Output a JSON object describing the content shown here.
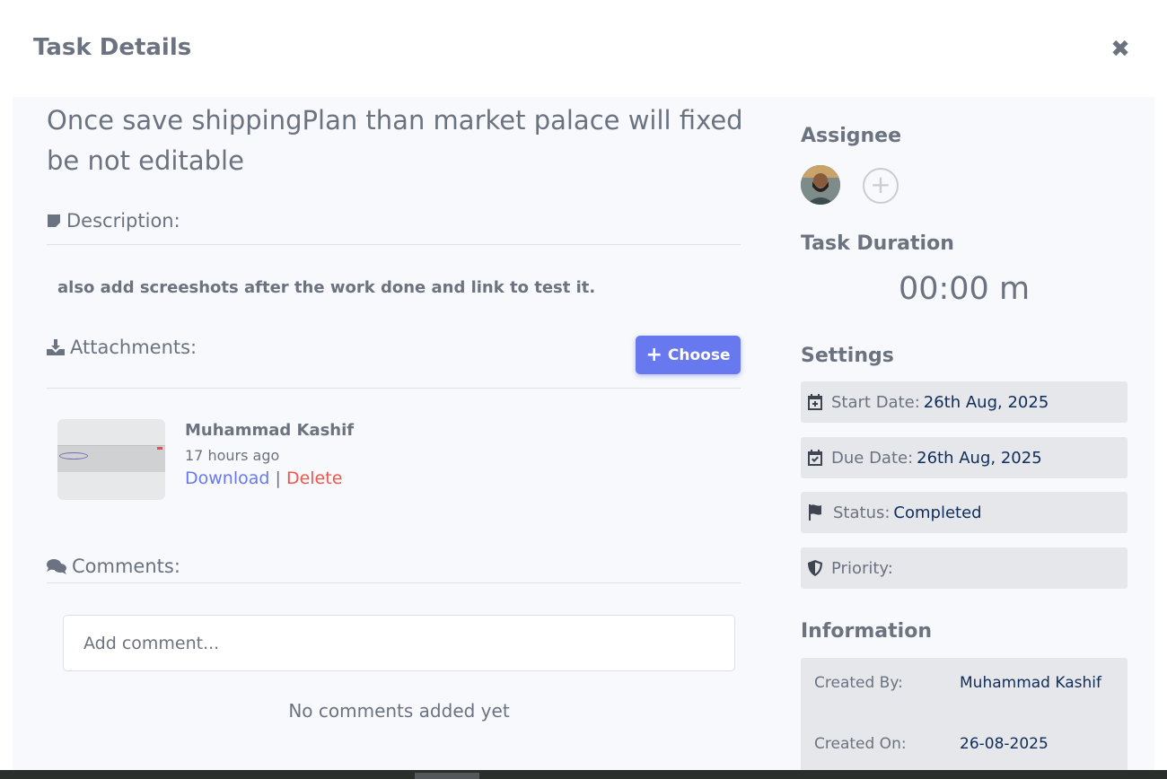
{
  "modal": {
    "title": "Task Details",
    "close_icon": "close-icon"
  },
  "task": {
    "title": "Once save shippingPlan than market palace will fixed be not editable"
  },
  "description": {
    "label": "Description:",
    "text": "also add screeshots  after the work done and link to test it."
  },
  "attachments": {
    "label": "Attachments:",
    "choose_label": "Choose",
    "items": [
      {
        "author": "Muhammad Kashif",
        "time": "17 hours ago",
        "download_label": "Download",
        "separator": "|",
        "delete_label": "Delete"
      }
    ]
  },
  "comments": {
    "label": "Comments:",
    "placeholder": "Add comment...",
    "empty_text": "No comments added yet"
  },
  "sidebar": {
    "assignee_heading": "Assignee",
    "duration_heading": "Task Duration",
    "duration_value": "00:00 m",
    "settings_heading": "Settings",
    "settings": {
      "start_label": "Start Date:",
      "start_value": "26th Aug, 2025",
      "due_label": "Due Date:",
      "due_value": "26th Aug, 2025",
      "status_label": "Status:",
      "status_value": "Completed",
      "priority_label": "Priority:"
    },
    "information_heading": "Information",
    "information": {
      "created_by_label": "Created By:",
      "created_by_value": "Muhammad Kashif",
      "created_on_label": "Created On:",
      "created_on_value": "26-08-2025"
    }
  },
  "colors": {
    "accent": "#6878ee",
    "danger": "#f0564b",
    "value_text": "#0f2d5a"
  }
}
